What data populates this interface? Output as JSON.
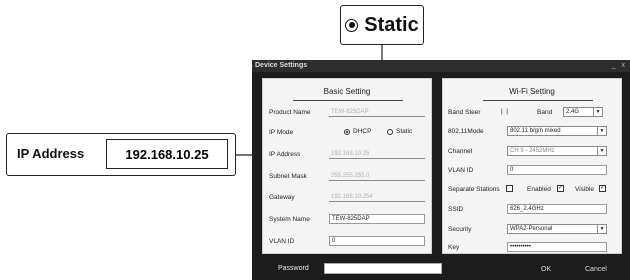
{
  "callouts": {
    "static_label": "Static",
    "ip_label": "IP Address",
    "ip_value": "192.168.10.25"
  },
  "window": {
    "title": "Device Settings",
    "controls": "_ x"
  },
  "basic": {
    "title": "Basic Setting",
    "product_name_label": "Product Name",
    "product_name_value": "TEW-825DAP",
    "ip_mode_label": "IP Mode",
    "ip_mode_options": [
      "DHCP",
      "Static"
    ],
    "ip_mode_selected": "DHCP",
    "ip_address_label": "IP Address",
    "ip_address_value": "192.168.10.25",
    "subnet_label": "Subnet Mask",
    "subnet_value": "255.255.255.0",
    "gateway_label": "Gateway",
    "gateway_value": "192.168.10.254",
    "system_name_label": "System Name",
    "system_name_value": "TEW-825DAP",
    "vlan_label": "VLAN ID",
    "vlan_value": "0"
  },
  "wifi": {
    "title": "Wi-Fi Setting",
    "band_steer_label": "Band Steer",
    "band_label": "Band",
    "band_value": "2.4G",
    "mode_label": "802.11Mode",
    "mode_value": "802.11 b/g/n mixed",
    "channel_label": "Channel",
    "channel_value": "CH 9 - 2452MHz",
    "vlan_label": "VLAN ID",
    "vlan_value": "0",
    "separate_label": "Separate Stations",
    "enabled_label": "Enabled",
    "visible_label": "Visible",
    "ssid_label": "SSID",
    "ssid_value": "626_2.4GHz",
    "security_label": "Security",
    "security_value": "WPA2-Personal",
    "key_label": "Key",
    "key_value": "••••••••••"
  },
  "footer": {
    "password_label": "Password",
    "ok_label": "OK",
    "cancel_label": "Cancel"
  }
}
